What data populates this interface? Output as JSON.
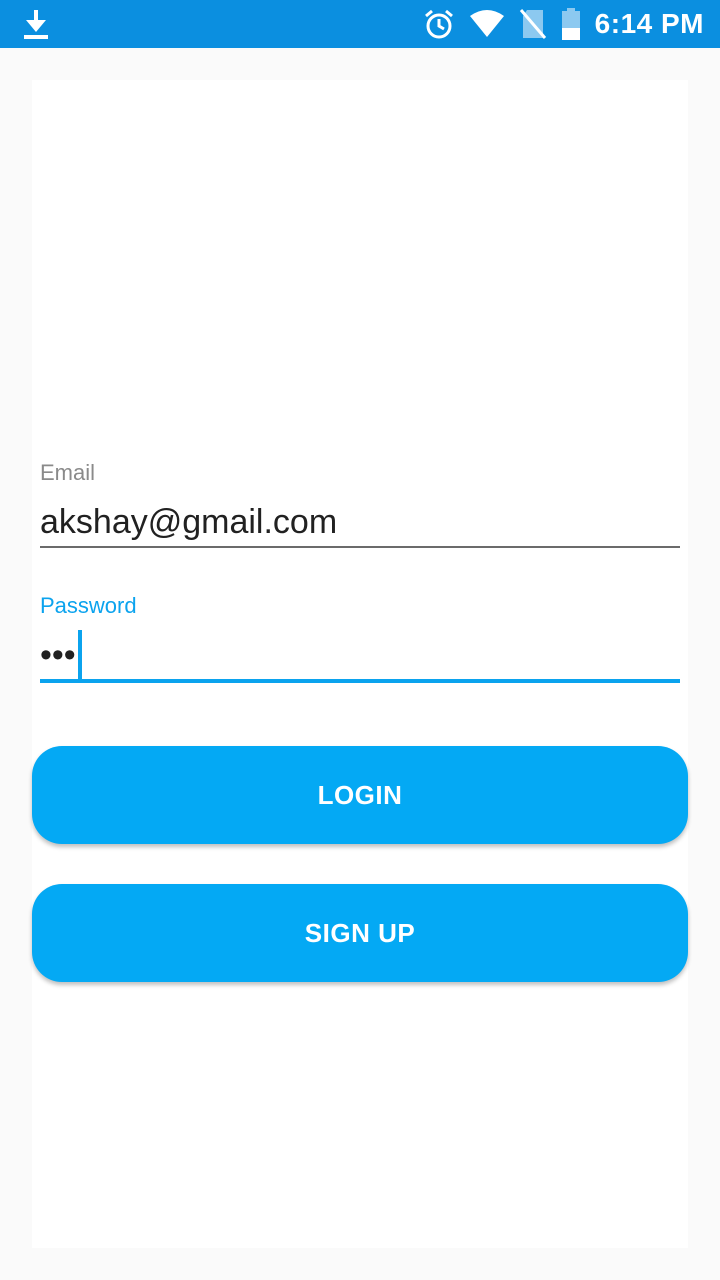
{
  "status_bar": {
    "time": "6:14 PM",
    "left_icon": "download-icon",
    "icons": [
      "alarm-icon",
      "wifi-icon",
      "no-sim-icon",
      "battery-icon"
    ],
    "background": "#0b8fe0"
  },
  "form": {
    "email": {
      "label": "Email",
      "value": "akshay@gmail.com"
    },
    "password": {
      "label": "Password",
      "value": "•••"
    }
  },
  "buttons": {
    "login_label": "LOGIN",
    "signup_label": "SIGN UP"
  },
  "colors": {
    "accent": "#0ba3ee",
    "button": "#04a9f4"
  }
}
